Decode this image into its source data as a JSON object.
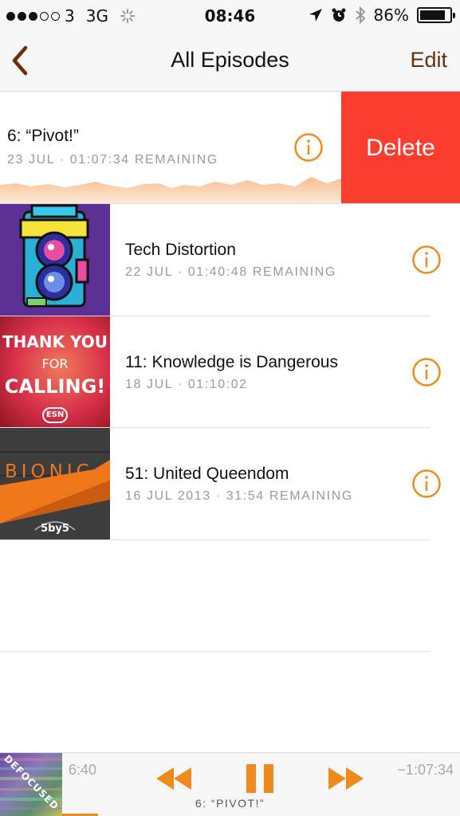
{
  "status_bar": {
    "carrier": "3",
    "network": "3G",
    "time": "08:46",
    "battery": "86%",
    "battery_level": 0.86
  },
  "nav": {
    "title": "All Episodes",
    "edit_label": "Edit",
    "back_icon": "chevron-left-icon"
  },
  "episodes": [
    {
      "title": "6: “Pivot!”",
      "subtitle": "23 JUL · 01:07:34 REMAINING"
    },
    {
      "title": "Tech Distortion",
      "subtitle": "22 JUL · 01:40:48 REMAINING"
    },
    {
      "title": "11: Knowledge is Dangerous",
      "subtitle": "18 JUL · 01:10:02"
    },
    {
      "title": "51: United Queendom",
      "subtitle": "16 JUL 2013 · 31:54 REMAINING"
    }
  ],
  "swipe_action": {
    "delete_label": "Delete"
  },
  "artwork_text": {
    "thank_you_line1": "THANK YOU",
    "thank_you_line2": "FOR",
    "thank_you_line3": "CALLING!",
    "esn": "ESN",
    "bionic": "BIONIC",
    "fiveby5": "5by5",
    "defocused": "DEFOCUSED"
  },
  "player": {
    "elapsed": "6:40",
    "remaining": "−1:07:34",
    "now_playing": "6: “PIVOT!”",
    "progress_fraction": 0.06
  },
  "colors": {
    "accent": "#f08a1c",
    "delete": "#fb3d2f",
    "edit": "#6b2e0b"
  }
}
